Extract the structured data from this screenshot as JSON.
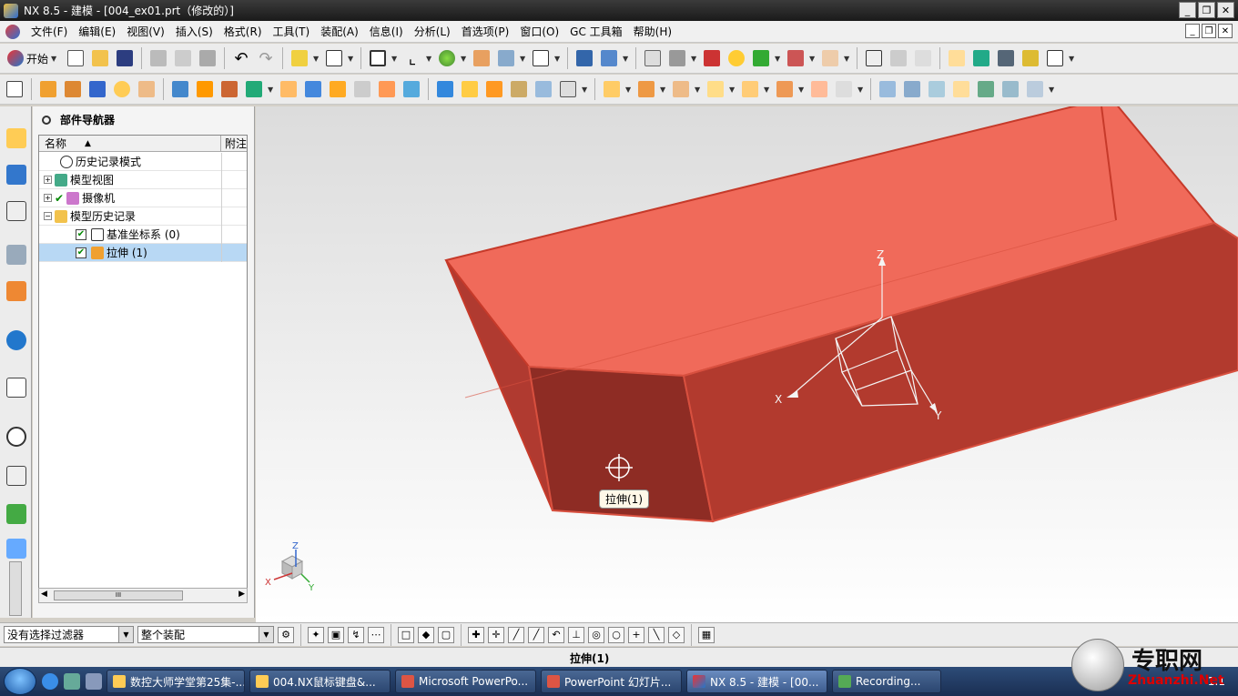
{
  "window": {
    "title": "NX 8.5 - 建模 - [004_ex01.prt（修改的）]",
    "minimize": "_",
    "restore": "❐",
    "close": "✕"
  },
  "menu": [
    "文件(F)",
    "编辑(E)",
    "视图(V)",
    "插入(S)",
    "格式(R)",
    "工具(T)",
    "装配(A)",
    "信息(I)",
    "分析(L)",
    "首选项(P)",
    "窗口(O)",
    "GC 工具箱",
    "帮助(H)"
  ],
  "toolbar": {
    "start_label": "开始"
  },
  "navigator": {
    "title": "部件导航器",
    "col_name": "名称",
    "col_note": "附注",
    "items": [
      {
        "label": "历史记录模式"
      },
      {
        "label": "模型视图"
      },
      {
        "label": "摄像机"
      },
      {
        "label": "模型历史记录"
      },
      {
        "label": "基准坐标系 (0)"
      },
      {
        "label": "拉伸 (1)"
      }
    ],
    "scroll_thumb": "III"
  },
  "viewport": {
    "tooltip": "拉伸(1)",
    "axis_x": "X",
    "axis_y": "Y",
    "axis_z": "Z",
    "triad_x": "X",
    "triad_y": "Y",
    "triad_z": "Z",
    "solid_color": "#e8584a"
  },
  "selection_bar": {
    "filter": "没有选择过滤器",
    "scope": "整个装配"
  },
  "status": {
    "text": "拉伸(1)"
  },
  "taskbar": {
    "tasks": [
      {
        "label": "数控大师学堂第25集-..."
      },
      {
        "label": "004.NX鼠标键盘&..."
      },
      {
        "label": "Microsoft PowerPo..."
      },
      {
        "label": "PowerPoint 幻灯片..."
      },
      {
        "label": "NX 8.5 - 建模 - [00..."
      },
      {
        "label": "Recording..."
      }
    ],
    "clock": "1:1"
  },
  "watermark": {
    "text": "专职网",
    "url": "Zhuanzhi.Net"
  }
}
